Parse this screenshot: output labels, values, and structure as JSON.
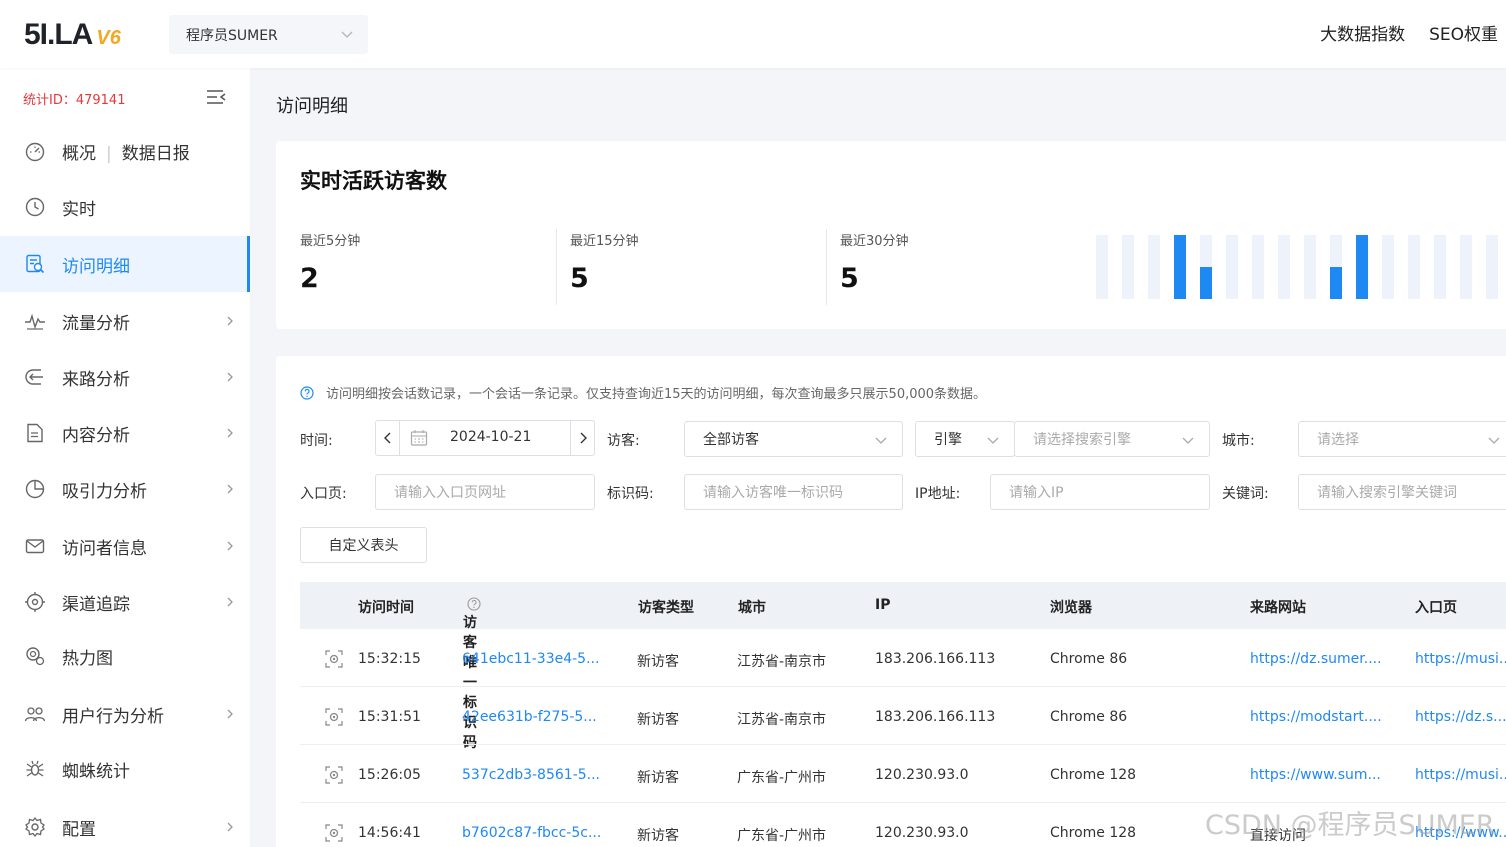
{
  "header": {
    "logo_text": "5I.LA",
    "logo_version": "V6",
    "site_select_value": "程序员SUMER",
    "links": [
      "大数据指数",
      "SEO权重"
    ]
  },
  "sidebar": {
    "stat_id": "统计ID：479141",
    "items": [
      {
        "label": "概况",
        "label2": "数据日报",
        "icon": "dashboard-icon",
        "has_arrow": false
      },
      {
        "label": "实时",
        "icon": "clock-icon",
        "has_arrow": false
      },
      {
        "label": "访问明细",
        "icon": "visit-detail-icon",
        "has_arrow": false,
        "active": true
      },
      {
        "label": "流量分析",
        "icon": "pulse-icon",
        "has_arrow": true
      },
      {
        "label": "来路分析",
        "icon": "source-icon",
        "has_arrow": true
      },
      {
        "label": "内容分析",
        "icon": "document-icon",
        "has_arrow": true
      },
      {
        "label": "吸引力分析",
        "icon": "pie-icon",
        "has_arrow": true
      },
      {
        "label": "访问者信息",
        "icon": "mail-icon",
        "has_arrow": true
      },
      {
        "label": "渠道追踪",
        "icon": "target-icon",
        "has_arrow": true
      },
      {
        "label": "热力图",
        "icon": "heatmap-icon",
        "has_arrow": false
      },
      {
        "label": "用户行为分析",
        "icon": "users-icon",
        "has_arrow": true
      },
      {
        "label": "蜘蛛统计",
        "icon": "spider-icon",
        "has_arrow": false
      },
      {
        "label": "配置",
        "icon": "gear-icon",
        "has_arrow": true
      }
    ]
  },
  "main": {
    "page_title": "访问明细",
    "realtime": {
      "title": "实时活跃访客数",
      "metrics": [
        {
          "label": "最近5分钟",
          "value": "2"
        },
        {
          "label": "最近15分钟",
          "value": "5"
        },
        {
          "label": "最近30分钟",
          "value": "5"
        }
      ],
      "bar_levels": [
        0,
        0,
        0,
        1,
        0.5,
        0,
        0,
        0,
        0,
        0.5,
        1,
        0,
        0,
        0,
        0,
        0
      ]
    },
    "notice": "访问明细按会话数记录，一个会话一条记录。仅支持查询近15天的访问明细，每次查询最多只展示50,000条数据。",
    "filters": {
      "time_label": "时间:",
      "date_value": "2024-10-21",
      "visitor_label": "访客:",
      "visitor_value": "全部访客",
      "engine_value": "引擎",
      "engine_placeholder": "请选择搜索引擎",
      "city_label": "城市:",
      "city_placeholder": "请选择",
      "entry_label": "入口页:",
      "entry_placeholder": "请输入入口页网址",
      "id_label": "标识码:",
      "id_placeholder": "请输入访客唯一标识码",
      "ip_label": "IP地址:",
      "ip_placeholder": "请输入IP",
      "keyword_label": "关键词:",
      "keyword_placeholder": "请输入搜索引擎关键词"
    },
    "custom_header_button": "自定义表头",
    "table": {
      "columns": [
        "访问时间",
        "访客唯一标识码",
        "访客类型",
        "城市",
        "IP",
        "浏览器",
        "来路网站",
        "入口页"
      ],
      "rows": [
        {
          "time": "15:32:15",
          "id": "641ebc11-33e4-5...",
          "type": "新访客",
          "city": "江苏省-南京市",
          "ip": "183.206.166.113",
          "browser": "Chrome 86",
          "referrer": "https://dz.sumer....",
          "entry": "https://musi..."
        },
        {
          "time": "15:31:51",
          "id": "42ee631b-f275-5...",
          "type": "新访客",
          "city": "江苏省-南京市",
          "ip": "183.206.166.113",
          "browser": "Chrome 86",
          "referrer": "https://modstart....",
          "entry": "https://dz.s..."
        },
        {
          "time": "15:26:05",
          "id": "537c2db3-8561-5...",
          "type": "新访客",
          "city": "广东省-广州市",
          "ip": "120.230.93.0",
          "browser": "Chrome 128",
          "referrer": "https://www.sum...",
          "entry": "https://musi..."
        },
        {
          "time": "14:56:41",
          "id": "b7602c87-fbcc-5c...",
          "type": "新访客",
          "city": "广东省-广州市",
          "ip": "120.230.93.0",
          "browser": "Chrome 128",
          "referrer": "直接访问",
          "entry": "https://www...."
        }
      ]
    }
  },
  "watermark": "CSDN @程序员SUMER",
  "colors": {
    "accent": "#1e88f3",
    "stat_id": "#e4393c",
    "logo_v": "#f5a623"
  }
}
